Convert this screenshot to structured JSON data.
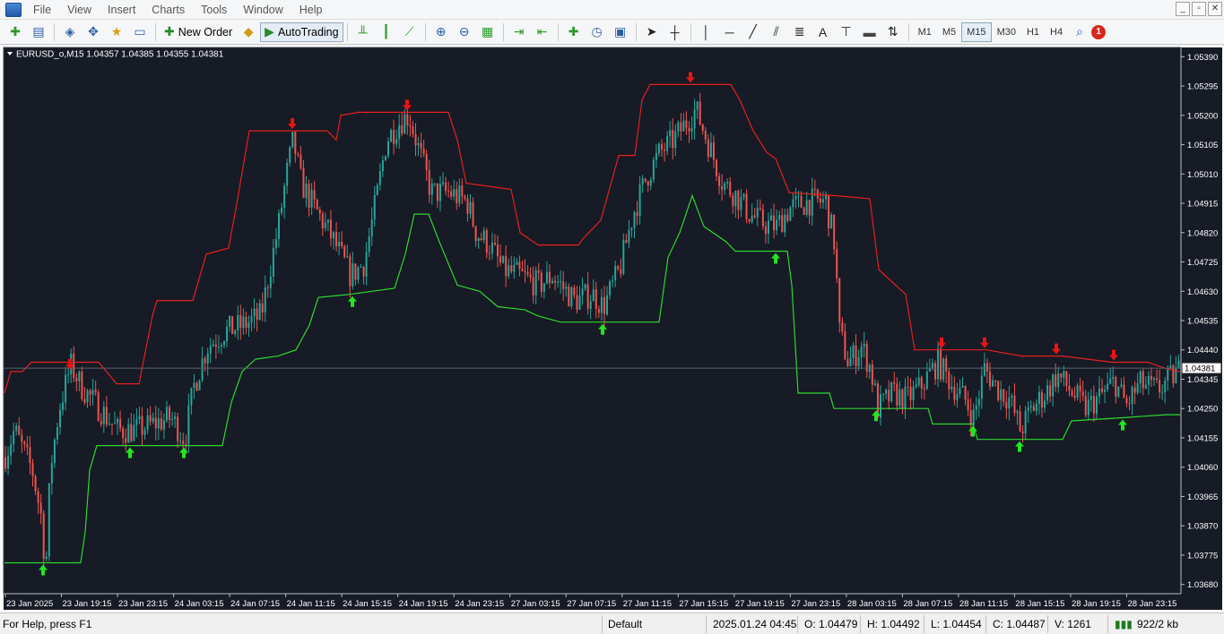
{
  "menu": [
    "File",
    "View",
    "Insert",
    "Charts",
    "Tools",
    "Window",
    "Help"
  ],
  "window_controls": [
    "_",
    "▫",
    "✕"
  ],
  "toolbar": {
    "new_order_label": "New Order",
    "autotrading_label": "AutoTrading",
    "timeframes": [
      "M1",
      "M5",
      "M15",
      "M30",
      "H1",
      "H4"
    ],
    "active_timeframe": "M15",
    "notification_count": "1"
  },
  "chart": {
    "header": "EURUSD_o,M15  1.04357 1.04385 1.04355 1.04381",
    "current_price_label": "1.04381",
    "price_axis": [
      "1.05390",
      "1.05295",
      "1.05200",
      "1.05105",
      "1.05010",
      "1.04915",
      "1.04820",
      "1.04725",
      "1.04630",
      "1.04535",
      "1.04440",
      "1.04345",
      "1.04250",
      "1.04155",
      "1.04060",
      "1.03965",
      "1.03870",
      "1.03775",
      "1.03680"
    ],
    "time_axis": [
      "23 Jan 2025",
      "23 Jan 19:15",
      "23 Jan 23:15",
      "24 Jan 03:15",
      "24 Jan 07:15",
      "24 Jan 11:15",
      "24 Jan 15:15",
      "24 Jan 19:15",
      "24 Jan 23:15",
      "27 Jan 03:15",
      "27 Jan 07:15",
      "27 Jan 11:15",
      "27 Jan 15:15",
      "27 Jan 19:15",
      "27 Jan 23:15",
      "28 Jan 03:15",
      "28 Jan 07:15",
      "28 Jan 11:15",
      "28 Jan 15:15",
      "28 Jan 19:15",
      "28 Jan 23:15"
    ],
    "colors": {
      "background": "#161b25",
      "bull": "#26a69a",
      "bear": "#ef5350",
      "upper_band": "#e52020",
      "lower_band": "#2ed82e",
      "sell_arrow": "#e81414",
      "buy_arrow": "#22e622",
      "text": "#ffffff"
    }
  },
  "chart_data": {
    "type": "candlestick",
    "symbol": "EURUSD_o",
    "timeframe": "M15",
    "last": {
      "open": 1.04357,
      "high": 1.04385,
      "low": 1.04355,
      "close": 1.04381
    },
    "ylim": [
      1.0365,
      1.0542
    ],
    "anchors": [
      {
        "x": 0,
        "v": 1.0406
      },
      {
        "x": 15,
        "v": 1.0418
      },
      {
        "x": 35,
        "v": 1.0405
      },
      {
        "x": 45,
        "v": 1.039
      },
      {
        "x": 50,
        "v": 1.0372
      },
      {
        "x": 55,
        "v": 1.0405
      },
      {
        "x": 65,
        "v": 1.0425
      },
      {
        "x": 78,
        "v": 1.0439
      },
      {
        "x": 90,
        "v": 1.0432
      },
      {
        "x": 110,
        "v": 1.0425
      },
      {
        "x": 130,
        "v": 1.0418
      },
      {
        "x": 150,
        "v": 1.0418
      },
      {
        "x": 170,
        "v": 1.042
      },
      {
        "x": 190,
        "v": 1.0422
      },
      {
        "x": 205,
        "v": 1.0415
      },
      {
        "x": 215,
        "v": 1.0432
      },
      {
        "x": 230,
        "v": 1.0445
      },
      {
        "x": 250,
        "v": 1.045
      },
      {
        "x": 270,
        "v": 1.0452
      },
      {
        "x": 290,
        "v": 1.0455
      },
      {
        "x": 300,
        "v": 1.047
      },
      {
        "x": 310,
        "v": 1.0485
      },
      {
        "x": 318,
        "v": 1.05
      },
      {
        "x": 326,
        "v": 1.0512
      },
      {
        "x": 335,
        "v": 1.0498
      },
      {
        "x": 350,
        "v": 1.049
      },
      {
        "x": 370,
        "v": 1.048
      },
      {
        "x": 390,
        "v": 1.0468
      },
      {
        "x": 405,
        "v": 1.0472
      },
      {
        "x": 420,
        "v": 1.0495
      },
      {
        "x": 430,
        "v": 1.0512
      },
      {
        "x": 445,
        "v": 1.0518
      },
      {
        "x": 455,
        "v": 1.052
      },
      {
        "x": 465,
        "v": 1.051
      },
      {
        "x": 480,
        "v": 1.0495
      },
      {
        "x": 500,
        "v": 1.0495
      },
      {
        "x": 520,
        "v": 1.0492
      },
      {
        "x": 530,
        "v": 1.0482
      },
      {
        "x": 545,
        "v": 1.0478
      },
      {
        "x": 560,
        "v": 1.047
      },
      {
        "x": 580,
        "v": 1.0468
      },
      {
        "x": 600,
        "v": 1.0465
      },
      {
        "x": 615,
        "v": 1.0468
      },
      {
        "x": 640,
        "v": 1.046
      },
      {
        "x": 660,
        "v": 1.0462
      },
      {
        "x": 672,
        "v": 1.0458
      },
      {
        "x": 690,
        "v": 1.047
      },
      {
        "x": 705,
        "v": 1.0488
      },
      {
        "x": 720,
        "v": 1.05
      },
      {
        "x": 735,
        "v": 1.0508
      },
      {
        "x": 750,
        "v": 1.0512
      },
      {
        "x": 765,
        "v": 1.0518
      },
      {
        "x": 775,
        "v": 1.0522
      },
      {
        "x": 790,
        "v": 1.051
      },
      {
        "x": 805,
        "v": 1.0498
      },
      {
        "x": 820,
        "v": 1.0494
      },
      {
        "x": 835,
        "v": 1.0488
      },
      {
        "x": 850,
        "v": 1.0485
      },
      {
        "x": 865,
        "v": 1.0484
      },
      {
        "x": 880,
        "v": 1.049
      },
      {
        "x": 900,
        "v": 1.0492
      },
      {
        "x": 920,
        "v": 1.0492
      },
      {
        "x": 930,
        "v": 1.0478
      },
      {
        "x": 935,
        "v": 1.045
      },
      {
        "x": 945,
        "v": 1.044
      },
      {
        "x": 960,
        "v": 1.0445
      },
      {
        "x": 970,
        "v": 1.0438
      },
      {
        "x": 978,
        "v": 1.0425
      },
      {
        "x": 995,
        "v": 1.043
      },
      {
        "x": 1010,
        "v": 1.0428
      },
      {
        "x": 1025,
        "v": 1.0432
      },
      {
        "x": 1045,
        "v": 1.044
      },
      {
        "x": 1060,
        "v": 1.0433
      },
      {
        "x": 1075,
        "v": 1.0428
      },
      {
        "x": 1085,
        "v": 1.0422
      },
      {
        "x": 1097,
        "v": 1.0438
      },
      {
        "x": 1110,
        "v": 1.0432
      },
      {
        "x": 1125,
        "v": 1.0428
      },
      {
        "x": 1137,
        "v": 1.0418
      },
      {
        "x": 1150,
        "v": 1.0425
      },
      {
        "x": 1165,
        "v": 1.043
      },
      {
        "x": 1178,
        "v": 1.0436
      },
      {
        "x": 1195,
        "v": 1.043
      },
      {
        "x": 1210,
        "v": 1.0425
      },
      {
        "x": 1230,
        "v": 1.043
      },
      {
        "x": 1242,
        "v": 1.0434
      },
      {
        "x": 1255,
        "v": 1.0426
      },
      {
        "x": 1270,
        "v": 1.0433
      },
      {
        "x": 1290,
        "v": 1.0431
      },
      {
        "x": 1316,
        "v": 1.0438
      }
    ],
    "upper_band": [
      {
        "x": 5,
        "v": 1.043
      },
      {
        "x": 12,
        "v": 1.0437
      },
      {
        "x": 25,
        "v": 1.0437
      },
      {
        "x": 35,
        "v": 1.044
      },
      {
        "x": 100,
        "v": 1.044
      },
      {
        "x": 110,
        "v": 1.044
      },
      {
        "x": 130,
        "v": 1.0433
      },
      {
        "x": 155,
        "v": 1.0433
      },
      {
        "x": 170,
        "v": 1.0455
      },
      {
        "x": 175,
        "v": 1.046
      },
      {
        "x": 215,
        "v": 1.046
      },
      {
        "x": 230,
        "v": 1.0475
      },
      {
        "x": 255,
        "v": 1.0477
      },
      {
        "x": 265,
        "v": 1.0493
      },
      {
        "x": 278,
        "v": 1.0515
      },
      {
        "x": 365,
        "v": 1.0515
      },
      {
        "x": 375,
        "v": 1.0512
      },
      {
        "x": 380,
        "v": 1.052
      },
      {
        "x": 400,
        "v": 1.0521
      },
      {
        "x": 500,
        "v": 1.0521
      },
      {
        "x": 510,
        "v": 1.0512
      },
      {
        "x": 520,
        "v": 1.0498
      },
      {
        "x": 570,
        "v": 1.0496
      },
      {
        "x": 580,
        "v": 1.0482
      },
      {
        "x": 600,
        "v": 1.0478
      },
      {
        "x": 645,
        "v": 1.0478
      },
      {
        "x": 650,
        "v": 1.048
      },
      {
        "x": 670,
        "v": 1.0486
      },
      {
        "x": 690,
        "v": 1.0507
      },
      {
        "x": 708,
        "v": 1.0507
      },
      {
        "x": 716,
        "v": 1.0525
      },
      {
        "x": 725,
        "v": 1.053
      },
      {
        "x": 815,
        "v": 1.053
      },
      {
        "x": 825,
        "v": 1.0525
      },
      {
        "x": 840,
        "v": 1.0515
      },
      {
        "x": 855,
        "v": 1.0508
      },
      {
        "x": 865,
        "v": 1.0506
      },
      {
        "x": 880,
        "v": 1.0495
      },
      {
        "x": 930,
        "v": 1.0494
      },
      {
        "x": 970,
        "v": 1.0493
      },
      {
        "x": 980,
        "v": 1.047
      },
      {
        "x": 1010,
        "v": 1.0462
      },
      {
        "x": 1020,
        "v": 1.0444
      },
      {
        "x": 1100,
        "v": 1.0444
      },
      {
        "x": 1140,
        "v": 1.0442
      },
      {
        "x": 1185,
        "v": 1.0442
      },
      {
        "x": 1240,
        "v": 1.044
      },
      {
        "x": 1280,
        "v": 1.044
      },
      {
        "x": 1300,
        "v": 1.0438
      },
      {
        "x": 1316,
        "v": 1.0437
      }
    ],
    "lower_band": [
      {
        "x": 5,
        "v": 1.0375
      },
      {
        "x": 90,
        "v": 1.0375
      },
      {
        "x": 95,
        "v": 1.0385
      },
      {
        "x": 100,
        "v": 1.0405
      },
      {
        "x": 108,
        "v": 1.0413
      },
      {
        "x": 248,
        "v": 1.0413
      },
      {
        "x": 258,
        "v": 1.0427
      },
      {
        "x": 270,
        "v": 1.0437
      },
      {
        "x": 285,
        "v": 1.0441
      },
      {
        "x": 310,
        "v": 1.0442
      },
      {
        "x": 330,
        "v": 1.0444
      },
      {
        "x": 345,
        "v": 1.0452
      },
      {
        "x": 355,
        "v": 1.0461
      },
      {
        "x": 390,
        "v": 1.0462
      },
      {
        "x": 440,
        "v": 1.0464
      },
      {
        "x": 452,
        "v": 1.0475
      },
      {
        "x": 462,
        "v": 1.0488
      },
      {
        "x": 478,
        "v": 1.0488
      },
      {
        "x": 490,
        "v": 1.0479
      },
      {
        "x": 510,
        "v": 1.0465
      },
      {
        "x": 535,
        "v": 1.0463
      },
      {
        "x": 555,
        "v": 1.0458
      },
      {
        "x": 585,
        "v": 1.0457
      },
      {
        "x": 600,
        "v": 1.0455
      },
      {
        "x": 625,
        "v": 1.0453
      },
      {
        "x": 735,
        "v": 1.0453
      },
      {
        "x": 745,
        "v": 1.0474
      },
      {
        "x": 758,
        "v": 1.0482
      },
      {
        "x": 772,
        "v": 1.0494
      },
      {
        "x": 785,
        "v": 1.0484
      },
      {
        "x": 810,
        "v": 1.0479
      },
      {
        "x": 820,
        "v": 1.0476
      },
      {
        "x": 878,
        "v": 1.0476
      },
      {
        "x": 883,
        "v": 1.0465
      },
      {
        "x": 890,
        "v": 1.043
      },
      {
        "x": 925,
        "v": 1.043
      },
      {
        "x": 930,
        "v": 1.0425
      },
      {
        "x": 1035,
        "v": 1.0425
      },
      {
        "x": 1040,
        "v": 1.042
      },
      {
        "x": 1085,
        "v": 1.042
      },
      {
        "x": 1090,
        "v": 1.0415
      },
      {
        "x": 1185,
        "v": 1.0415
      },
      {
        "x": 1195,
        "v": 1.0421
      },
      {
        "x": 1250,
        "v": 1.0422
      },
      {
        "x": 1300,
        "v": 1.0423
      },
      {
        "x": 1316,
        "v": 1.0423
      }
    ],
    "sell_arrows": [
      {
        "x": 78,
        "v": 1.0437
      },
      {
        "x": 326,
        "v": 1.0515
      },
      {
        "x": 454,
        "v": 1.0521
      },
      {
        "x": 770,
        "v": 1.053
      },
      {
        "x": 1050,
        "v": 1.0444
      },
      {
        "x": 1098,
        "v": 1.0444
      },
      {
        "x": 1178,
        "v": 1.0442
      },
      {
        "x": 1242,
        "v": 1.044
      }
    ],
    "buy_arrows": [
      {
        "x": 48,
        "v": 1.0375
      },
      {
        "x": 145,
        "v": 1.0413
      },
      {
        "x": 205,
        "v": 1.0413
      },
      {
        "x": 393,
        "v": 1.0462
      },
      {
        "x": 672,
        "v": 1.0453
      },
      {
        "x": 865,
        "v": 1.0476
      },
      {
        "x": 977,
        "v": 1.0425
      },
      {
        "x": 1085,
        "v": 1.042
      },
      {
        "x": 1137,
        "v": 1.0415
      },
      {
        "x": 1252,
        "v": 1.0422
      }
    ]
  },
  "status": {
    "help": "For Help, press F1",
    "profile": "Default",
    "datetime": "2025.01.24 04:45",
    "open": "O: 1.04479",
    "high": "H: 1.04492",
    "low": "L: 1.04454",
    "close": "C: 1.04487",
    "volume": "V: 1261",
    "traffic": "922/2 kb"
  }
}
